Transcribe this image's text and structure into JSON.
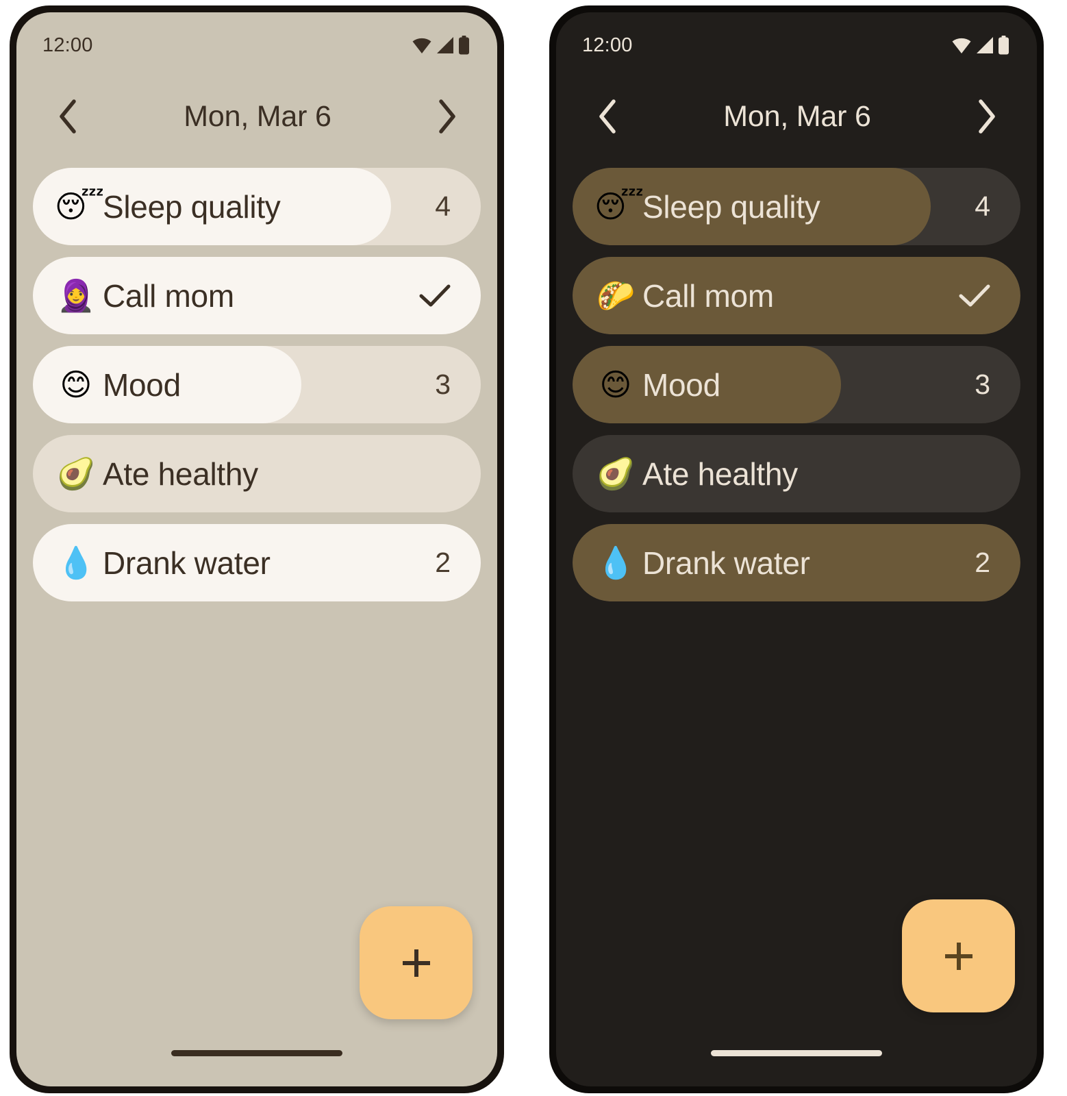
{
  "screens": [
    {
      "theme": "light",
      "statusbar": {
        "time": "12:00",
        "icons": [
          "wifi-icon",
          "cellular-signal-icon",
          "battery-icon"
        ]
      },
      "appbar": {
        "prev_label": "chevron-left-icon",
        "title": "Mon, Mar 6",
        "next_label": "chevron-right-icon"
      },
      "habits": [
        {
          "emoji": "😴",
          "emoji_name": "sleeping-face-emoji",
          "label": "Sleep quality",
          "value": "4",
          "percent": 80,
          "type": "counter"
        },
        {
          "emoji": "🧕",
          "emoji_name": "woman-with-headscarf-emoji",
          "label": "Call mom",
          "value": "✓",
          "percent": 100,
          "type": "check"
        },
        {
          "emoji": "😊",
          "emoji_name": "smiling-face-emoji",
          "label": "Mood",
          "value": "3",
          "percent": 60,
          "type": "counter"
        },
        {
          "emoji": "🥑",
          "emoji_name": "avocado-emoji",
          "label": "Ate healthy",
          "value": "",
          "percent": 0,
          "type": "empty"
        },
        {
          "emoji": "💧",
          "emoji_name": "droplet-emoji",
          "label": "Drank water",
          "value": "2",
          "percent": 100,
          "type": "counter"
        }
      ],
      "fab": {
        "label": "+",
        "name": "add-habit-button"
      },
      "colors": {
        "background": "#CBC4B4",
        "track": "#E6DED2",
        "fill": "#F9F5F0",
        "text": "#3B2F24",
        "accent": "#F9C77E"
      }
    },
    {
      "theme": "dark",
      "statusbar": {
        "time": "12:00",
        "icons": [
          "wifi-icon",
          "cellular-signal-icon",
          "battery-icon"
        ]
      },
      "appbar": {
        "prev_label": "chevron-left-icon",
        "title": "Mon, Mar 6",
        "next_label": "chevron-right-icon"
      },
      "habits": [
        {
          "emoji": "😴",
          "emoji_name": "sleeping-face-emoji",
          "label": "Sleep quality",
          "value": "4",
          "percent": 80,
          "type": "counter"
        },
        {
          "emoji": "🌮",
          "emoji_name": "taco-emoji",
          "label": "Call mom",
          "value": "✓",
          "percent": 100,
          "type": "check"
        },
        {
          "emoji": "😊",
          "emoji_name": "smiling-face-emoji",
          "label": "Mood",
          "value": "3",
          "percent": 60,
          "type": "counter"
        },
        {
          "emoji": "🥑",
          "emoji_name": "avocado-emoji",
          "label": "Ate healthy",
          "value": "",
          "percent": 0,
          "type": "empty"
        },
        {
          "emoji": "💧",
          "emoji_name": "droplet-emoji",
          "label": "Drank water",
          "value": "2",
          "percent": 100,
          "type": "counter"
        }
      ],
      "fab": {
        "label": "+",
        "name": "add-habit-button"
      },
      "colors": {
        "background": "#211E1B",
        "track": "#3A3632",
        "fill": "#6B5939",
        "text": "#ECE3D6",
        "accent": "#F9C77E"
      }
    }
  ]
}
